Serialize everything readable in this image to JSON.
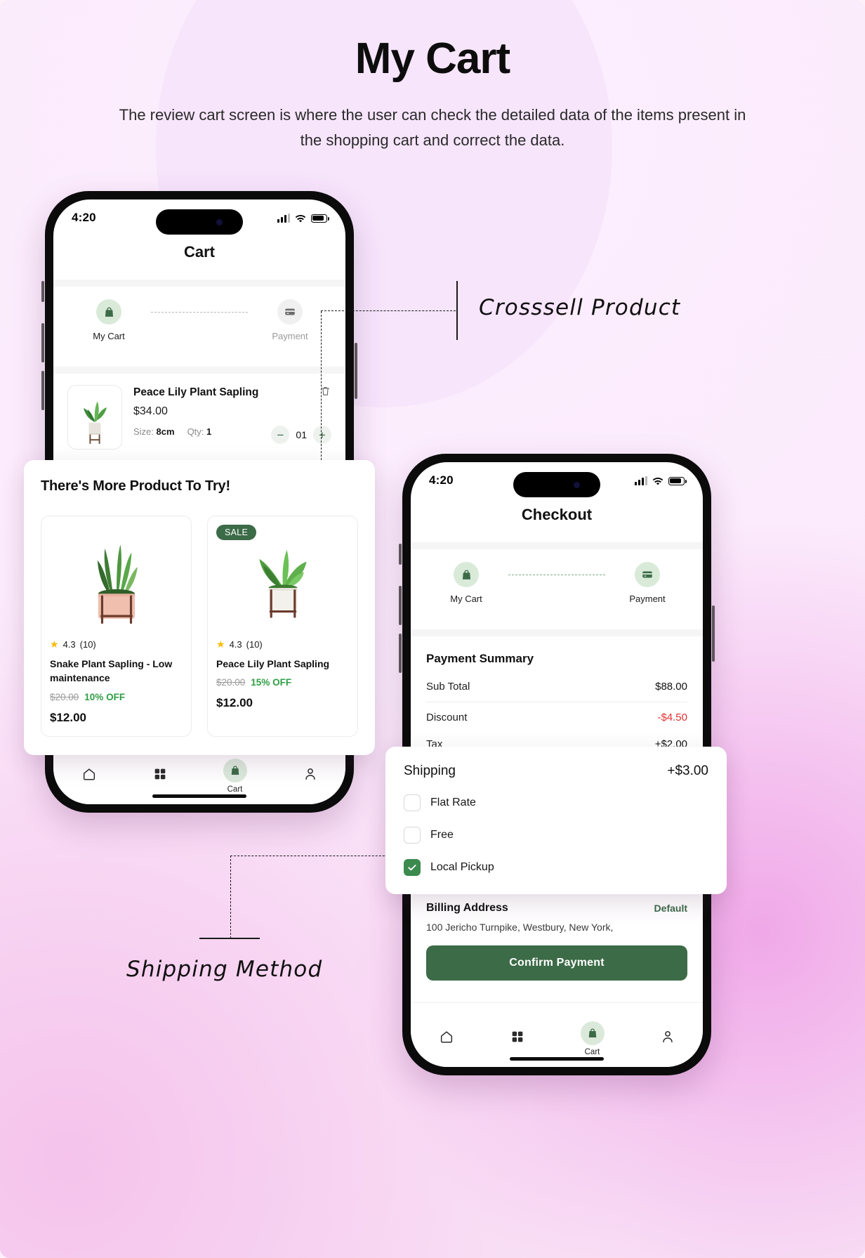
{
  "header": {
    "title": "My Cart",
    "subtitle": "The review cart screen is where the user can check the detailed data of the items present in the shopping cart and correct the data."
  },
  "annotations": [
    {
      "label": "Crosssell Product"
    },
    {
      "label": "Shipping Method"
    }
  ],
  "cart_phone": {
    "status": {
      "time": "4:20",
      "signal_icon": "signal-bars-icon",
      "wifi_icon": "wifi-icon",
      "battery_icon": "battery-icon"
    },
    "app_title": "Cart",
    "stepper": [
      {
        "label": "My Cart",
        "icon": "shopping-bag-icon",
        "state": "active"
      },
      {
        "label": "Payment",
        "icon": "credit-card-icon",
        "state": "inactive"
      }
    ],
    "item": {
      "name": "Peace Lily Plant Sapling",
      "price": "$34.00",
      "size_label": "Size:",
      "size_value": "8cm",
      "qty_label": "Qty:",
      "qty_value": "1",
      "stepper_value": "01",
      "minus": "−",
      "plus": "+",
      "delete_icon": "trash-icon"
    },
    "bottom_nav": [
      {
        "label": "",
        "icon": "home-icon"
      },
      {
        "label": "",
        "icon": "grid-icon"
      },
      {
        "label": "Cart",
        "icon": "shopping-bag-icon"
      },
      {
        "label": "",
        "icon": "person-icon"
      }
    ]
  },
  "crosssell": {
    "title": "There's  More Product To Try!",
    "products": [
      {
        "badge": "",
        "rating": "4.3",
        "reviews": "(10)",
        "name": "Snake Plant Sapling - Low maintenance",
        "old_price": "$20.00",
        "discount": "10% OFF",
        "price": "$12.00"
      },
      {
        "badge": "SALE",
        "rating": "4.3",
        "reviews": "(10)",
        "name": "Peace Lily Plant Sapling",
        "old_price": "$20.00",
        "discount": "15% OFF",
        "price": "$12.00"
      }
    ]
  },
  "checkout_phone": {
    "status": {
      "time": "4:20",
      "signal_icon": "signal-bars-icon",
      "wifi_icon": "wifi-icon",
      "battery_icon": "battery-icon"
    },
    "app_title": "Checkout",
    "stepper": [
      {
        "label": "My Cart",
        "icon": "shopping-bag-icon",
        "state": "active"
      },
      {
        "label": "Payment",
        "icon": "credit-card-icon",
        "state": "active"
      }
    ],
    "summary_title": "Payment Summary",
    "summary_rows": [
      {
        "label": "Sub Total",
        "value": "$88.00",
        "tone": "dark"
      },
      {
        "label": "Discount",
        "value": "-$4.50",
        "tone": "red"
      },
      {
        "label": "Tax",
        "value": "+$2.00",
        "tone": "dark"
      },
      {
        "label": "Shipping",
        "value": "+$3.00",
        "tone": "dark"
      }
    ],
    "billing": {
      "title": "Billing Address",
      "default_tag": "Default",
      "address": "100 Jericho Turnpike, Westbury, New York,"
    },
    "confirm_label": "Confirm Payment",
    "bottom_nav": [
      {
        "label": "",
        "icon": "home-icon"
      },
      {
        "label": "",
        "icon": "grid-icon"
      },
      {
        "label": "Cart",
        "icon": "shopping-bag-icon"
      },
      {
        "label": "",
        "icon": "person-icon"
      }
    ]
  },
  "shipping_card": {
    "title": "Shipping",
    "amount": "+$3.00",
    "options": [
      {
        "label": "Flat Rate",
        "checked": false
      },
      {
        "label": "Free",
        "checked": false
      },
      {
        "label": "Local Pickup",
        "checked": true
      }
    ]
  },
  "colors": {
    "brand_green": "#3c6b47",
    "accent_red": "#e03131",
    "discount_green": "#2f9e44",
    "star_yellow": "#fbbc05"
  }
}
